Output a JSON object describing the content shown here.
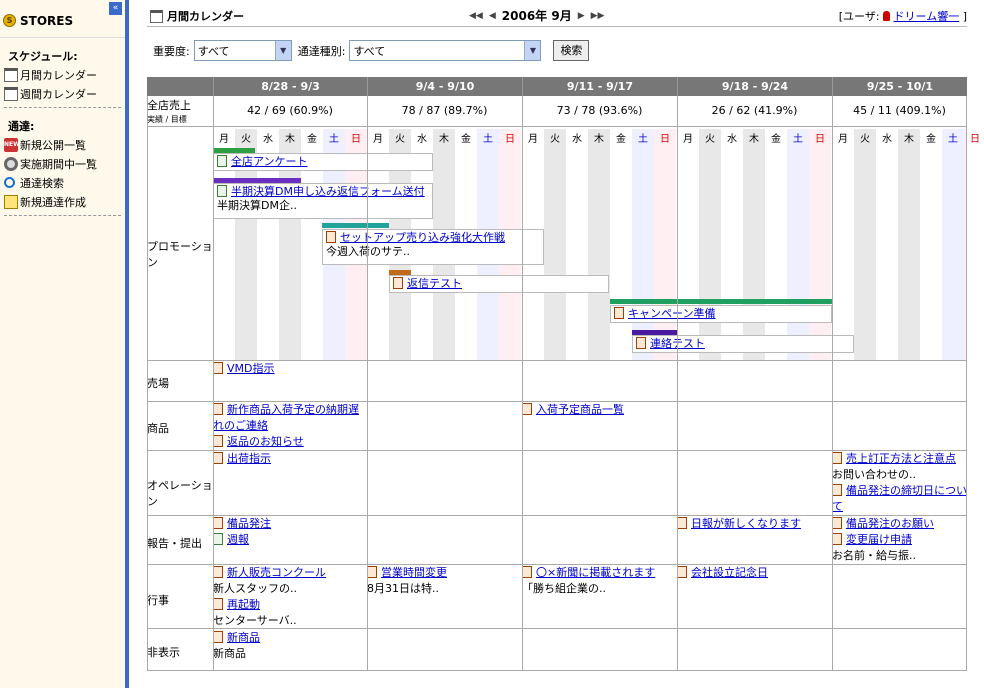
{
  "sidebar": {
    "title": "STORES",
    "schedule_label": "スケジュール:",
    "monthly": "月間カレンダー",
    "weekly": "週間カレンダー",
    "notice_label": "通達:",
    "new_public": "新規公開一覧",
    "in_period": "実施期間中一覧",
    "search": "通達検索",
    "create": "新規通達作成"
  },
  "header": {
    "title": "月間カレンダー",
    "month": "2006年 9月",
    "user_prefix": "[ユーザ:",
    "user_name": "ドリーム響一",
    "user_suffix": "]"
  },
  "filters": {
    "importance_label": "重要度:",
    "importance_value": "すべて",
    "type_label": "通達種別:",
    "type_value": "すべて",
    "search_button": "検索"
  },
  "weeks": [
    "8/28 - 9/3",
    "9/4 - 9/10",
    "9/11 - 9/17",
    "9/18 - 9/24",
    "9/25 - 10/1"
  ],
  "sales": {
    "label": "全店売上",
    "sub": "実績 / 目標",
    "values": [
      "42 / 69 (60.9%)",
      "78 / 87 (89.7%)",
      "73 / 78 (93.6%)",
      "26 / 62 (41.9%)",
      "45 / 11 (409.1%)"
    ]
  },
  "days": [
    "月",
    "火",
    "水",
    "木",
    "金",
    "土",
    "日"
  ],
  "rows": {
    "promo": "プロモーション",
    "floor": "売場",
    "product": "商品",
    "ops": "オペレーション",
    "report": "報告・提出",
    "event": "行事",
    "hidden": "非表示"
  },
  "promos": [
    {
      "title": "全店アンケート",
      "bar": "#2ea043"
    },
    {
      "title": "半期決算DM申し込み返信フォーム送付",
      "desc": "半期決算DM企..",
      "bar": "#6a2ec0"
    },
    {
      "title": "セットアップ売り込み強化大作戦",
      "desc": "今週入荷のサテ..",
      "bar": "#21a39a"
    },
    {
      "title": "返信テスト",
      "bar": "#c06a1a"
    },
    {
      "title": "キャンペーン準備",
      "bar": "#1fa060"
    },
    {
      "title": "連絡テスト",
      "bar": "#4a1aa0"
    }
  ],
  "items": {
    "floor_w1": "VMD指示",
    "prod_w1a": "新作商品入荷予定の納期遅れのご連絡",
    "prod_w1b": "返品のお知らせ",
    "prod_w3": "入荷予定商品一覧",
    "ops_w1": "出荷指示",
    "ops_w5a": "売上訂正方法と注意点",
    "ops_w5a_desc": "お問い合わせの..",
    "ops_w5b": "備品発注の締切日について",
    "rep_w1a": "備品発注",
    "rep_w1b": "週報",
    "rep_w4": "日報が新しくなります",
    "rep_w5a": "備品発注のお願い",
    "rep_w5b": "変更届け申請",
    "rep_w5b_desc": "お名前・給与振..",
    "ev_w1a": "新人販売コンクール",
    "ev_w1a_desc": "新人スタッフの..",
    "ev_w1b": "再起動",
    "ev_w1b_desc": "センターサーバ..",
    "ev_w2": "営業時間変更",
    "ev_w2_desc": "8月31日は特..",
    "ev_w3": "〇×新聞に掲載されます",
    "ev_w3_desc": "「勝ち組企業の..",
    "ev_w4": "会社設立記念日",
    "hid_w1": "新商品",
    "hid_w1_desc": "新商品"
  }
}
